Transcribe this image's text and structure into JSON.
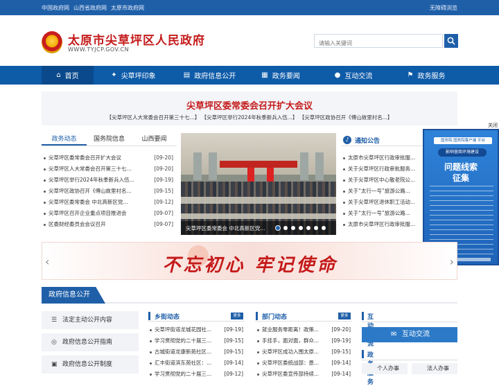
{
  "topbar": {
    "links": [
      "中国政府网",
      "山西省政府网",
      "太原市政府网"
    ],
    "accessibility": "无障碍浏览"
  },
  "header": {
    "title": "太原市尖草坪区人民政府",
    "url": "WWW.TYJCP.GOV.CN",
    "search_placeholder": "请输入关键词"
  },
  "nav": {
    "items": [
      {
        "label": "首页",
        "icon": "home-icon",
        "active": true
      },
      {
        "label": "尖草坪印象",
        "icon": "lightbulb-icon"
      },
      {
        "label": "政府信息公开",
        "icon": "document-icon"
      },
      {
        "label": "政务要闻",
        "icon": "newspaper-icon"
      },
      {
        "label": "互动交流",
        "icon": "chat-icon"
      },
      {
        "label": "政务服务",
        "icon": "flag-icon"
      }
    ]
  },
  "headline": {
    "title": "尖草坪区委常委会召开扩大会议",
    "sub": "【尖草坪区人大常委会召开第三十七...】 【尖草坪区举行2024年秋季新兵入伍...】 【尖草坪区政协召开《傅山故里村名...】"
  },
  "news": {
    "tabs": [
      "政务动态",
      "国务院信息",
      "山西要闻"
    ],
    "items": [
      {
        "title": "尖草坪区委常委会召开扩大会议",
        "date": "[09-20]"
      },
      {
        "title": "尖草坪区人大常委会召开第三十七...",
        "date": "[09-20]"
      },
      {
        "title": "尖草坪区举行2024年秋季新兵入伍...",
        "date": "[09-19]"
      },
      {
        "title": "尖草坪区政协召开《傅山故里村名...",
        "date": "[09-15]"
      },
      {
        "title": "尖草坪区委常委会 中北高新区党...",
        "date": "[09-12]"
      },
      {
        "title": "尖草坪区召开企业重点项目推进会",
        "date": "[09-07]"
      },
      {
        "title": "区委财经委员会会议召开",
        "date": "[09-07]"
      }
    ]
  },
  "photo": {
    "caption": "尖草坪区委常委会 中北高新区党...",
    "slides": 7,
    "active_slide": 1
  },
  "notice": {
    "title": "通知公告",
    "items": [
      "太原市尖草坪区行政审批服...",
      "关于尖草坪区行政审批服务...",
      "关于尖草坪区中心敬老院公...",
      "关于“太行一号”旅游公路...",
      "关于尖草坪区退休职工活动...",
      "关于“太行一号”旅游公路...",
      "太原市尖草坪区行政审批服..."
    ]
  },
  "float_ad": {
    "close": "关闭",
    "badge": "国务院 国务院客户端 平台",
    "ribbon": "影响营商环境建设",
    "line1": "问题线索",
    "line2": "征集"
  },
  "slogan": {
    "text": "不忘初心 牢记使命",
    "prev": "‹",
    "next": "›"
  },
  "info_open": {
    "title": "政府信息公开",
    "items": [
      {
        "label": "法定主动公开内容",
        "icon": "list-icon"
      },
      {
        "label": "政府信息公开指南",
        "icon": "compass-icon"
      },
      {
        "label": "政府信息公开制度",
        "icon": "book-icon"
      }
    ]
  },
  "township": {
    "title": "乡街动态",
    "more": "更多",
    "items": [
      {
        "title": "尖草坪街道龙城花园社...",
        "date": "[09-19]"
      },
      {
        "title": "学习贯彻党的二十届三...",
        "date": "[09-15]"
      },
      {
        "title": "古城街道龙康新苑社区...",
        "date": "[09-15]"
      },
      {
        "title": "汇丰街道滨东苑社区：...",
        "date": "[09-14]"
      },
      {
        "title": "学习贯彻党的二十届三...",
        "date": "[09-12]"
      }
    ]
  },
  "dept": {
    "title": "部门动态",
    "more": "更多",
    "items": [
      {
        "title": "就业服务零距离！政策...",
        "date": "[09-20]"
      },
      {
        "title": "手挂手，面对面，群众...",
        "date": "[09-19]"
      },
      {
        "title": "尖草坪区成功入围太原...",
        "date": "[09-15]"
      },
      {
        "title": "尖草坪区委统战部：恩...",
        "date": "[09-14]"
      },
      {
        "title": "尖草坪区委宣传部持续...",
        "date": "[09-14]"
      }
    ]
  },
  "interaction": {
    "title": "互动交流",
    "button": "互动交流",
    "services_title": "政务服务",
    "services": [
      "个人办事",
      "法人办事"
    ]
  }
}
